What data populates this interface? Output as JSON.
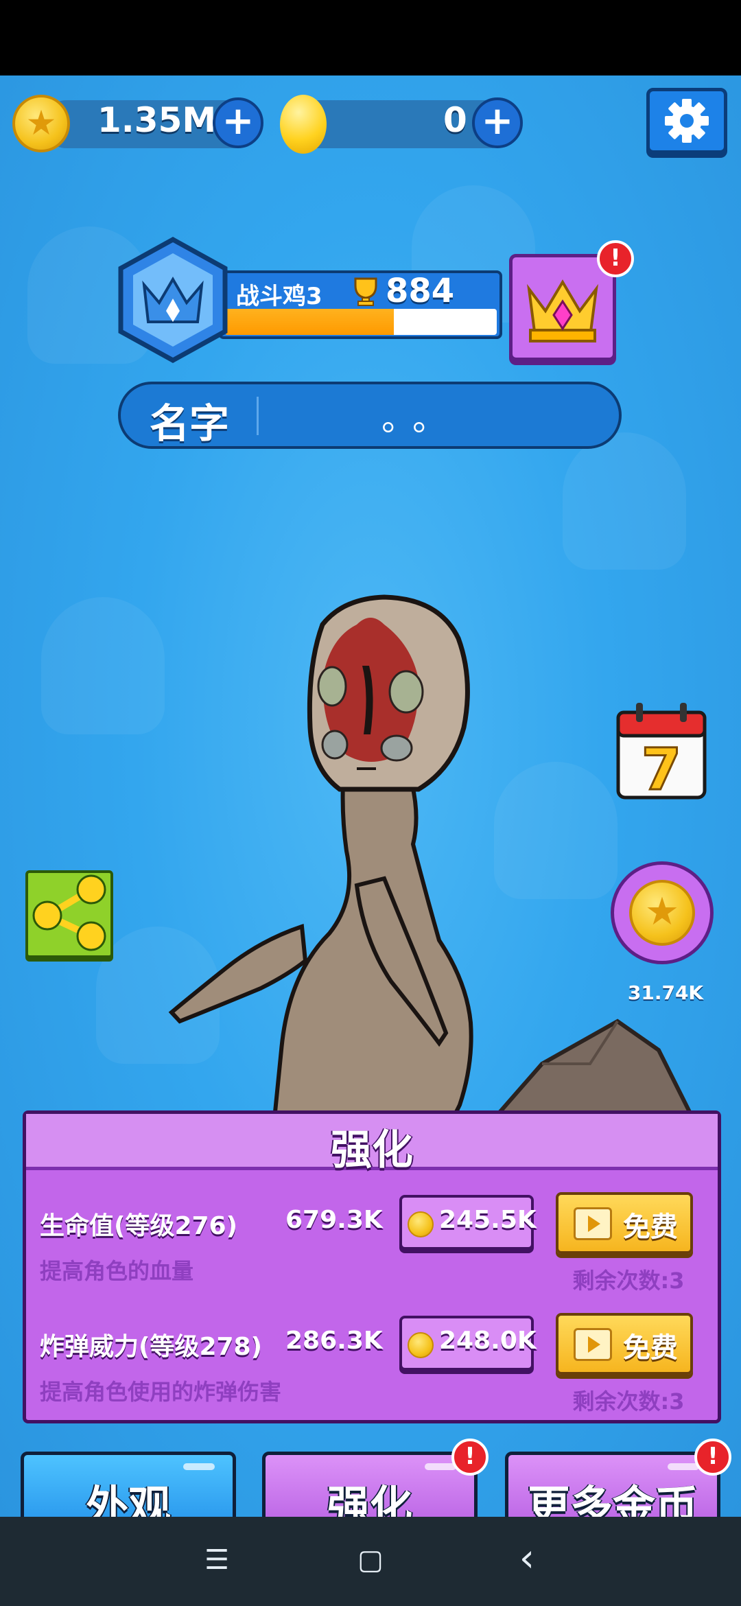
{
  "currency": {
    "coins": "1.35M",
    "gems": "0"
  },
  "rank": {
    "name": "战斗鸡3",
    "score": "884",
    "progress": 0.62
  },
  "name_bar": {
    "label": "名字",
    "value": "。。"
  },
  "side": {
    "calendar_day": "7",
    "coin_reward": "31.74K"
  },
  "upgrade_panel": {
    "title": "强化",
    "rows": [
      {
        "name": "生命值(等级276)",
        "value": "679.3K",
        "desc": "提高角色的血量",
        "cost": "245.5K",
        "free_label": "免费",
        "remaining": "剩余次数:3"
      },
      {
        "name": "炸弹威力(等级278)",
        "value": "286.3K",
        "desc": "提高角色使用的炸弹伤害",
        "cost": "248.0K",
        "free_label": "免费",
        "remaining": "剩余次数:3"
      }
    ]
  },
  "tabs": [
    {
      "label": "外观"
    },
    {
      "label": "强化"
    },
    {
      "label": "更多金币"
    }
  ],
  "alerts": {
    "mark": "!"
  },
  "nav": {
    "menu": "☰",
    "home": "▢",
    "back": "‹"
  }
}
